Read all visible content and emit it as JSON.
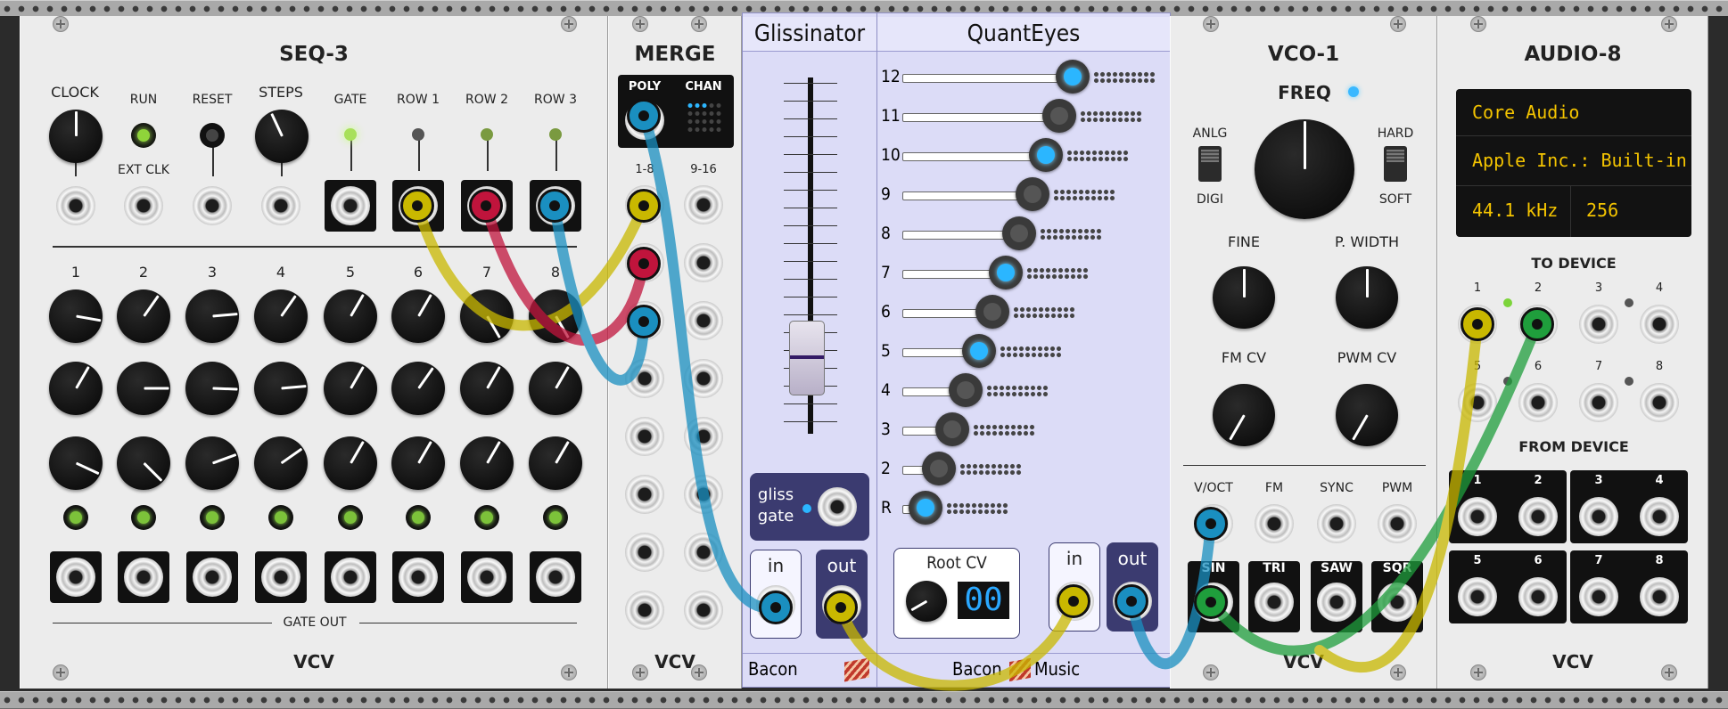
{
  "seq3": {
    "title": "SEQ-3",
    "clock": "CLOCK",
    "run": "RUN",
    "reset": "RESET",
    "steps": "STEPS",
    "ext_clk": "EXT CLK",
    "gate": "GATE",
    "row1": "ROW 1",
    "row2": "ROW 2",
    "row3": "ROW 3",
    "step_labels": [
      "1",
      "2",
      "3",
      "4",
      "5",
      "6",
      "7",
      "8"
    ],
    "gate_out": "GATE OUT",
    "brand": "VCV"
  },
  "merge": {
    "title": "MERGE",
    "poly": "POLY",
    "chan": "CHAN",
    "col1": "1-8",
    "col2": "9-16",
    "brand": "VCV"
  },
  "glissinator": {
    "title": "Glissinator",
    "gliss_gate_1": "gliss",
    "gliss_gate_2": "gate",
    "in": "in",
    "out": "out",
    "brand": "Bacon"
  },
  "quanteyes": {
    "title": "QuantEyes",
    "rows": [
      "12",
      "11",
      "10",
      "9",
      "8",
      "7",
      "6",
      "5",
      "4",
      "3",
      "2",
      "R"
    ],
    "root_cv": "Root CV",
    "root_value": "00",
    "in": "in",
    "out": "out",
    "brand_1": "Bacon",
    "brand_2": "Music"
  },
  "vco1": {
    "title": "VCO-1",
    "freq": "FREQ",
    "anlg": "ANLG",
    "digi": "DIGI",
    "hard": "HARD",
    "soft": "SOFT",
    "fine": "FINE",
    "pwidth": "P. WIDTH",
    "fmcv": "FM CV",
    "pwmcv": "PWM CV",
    "inputs": [
      "V/OCT",
      "FM",
      "SYNC",
      "PWM"
    ],
    "outputs": [
      "SIN",
      "TRI",
      "SAW",
      "SQR"
    ],
    "brand": "VCV"
  },
  "audio8": {
    "title": "AUDIO-8",
    "driver": "Core Audio",
    "device": "Apple Inc.: Built-in",
    "sample_rate": "44.1 kHz",
    "block_size": "256",
    "to_device": "TO DEVICE",
    "from_device": "FROM DEVICE",
    "channels": [
      "1",
      "2",
      "3",
      "4",
      "5",
      "6",
      "7",
      "8"
    ],
    "brand": "VCV"
  },
  "colors": {
    "yellow": "#c9b800",
    "red": "#c0143c",
    "blue": "#1a8fc0",
    "green": "#1f9e3c",
    "panel": "#ececec",
    "bacon_panel": "#dcdcf7"
  }
}
